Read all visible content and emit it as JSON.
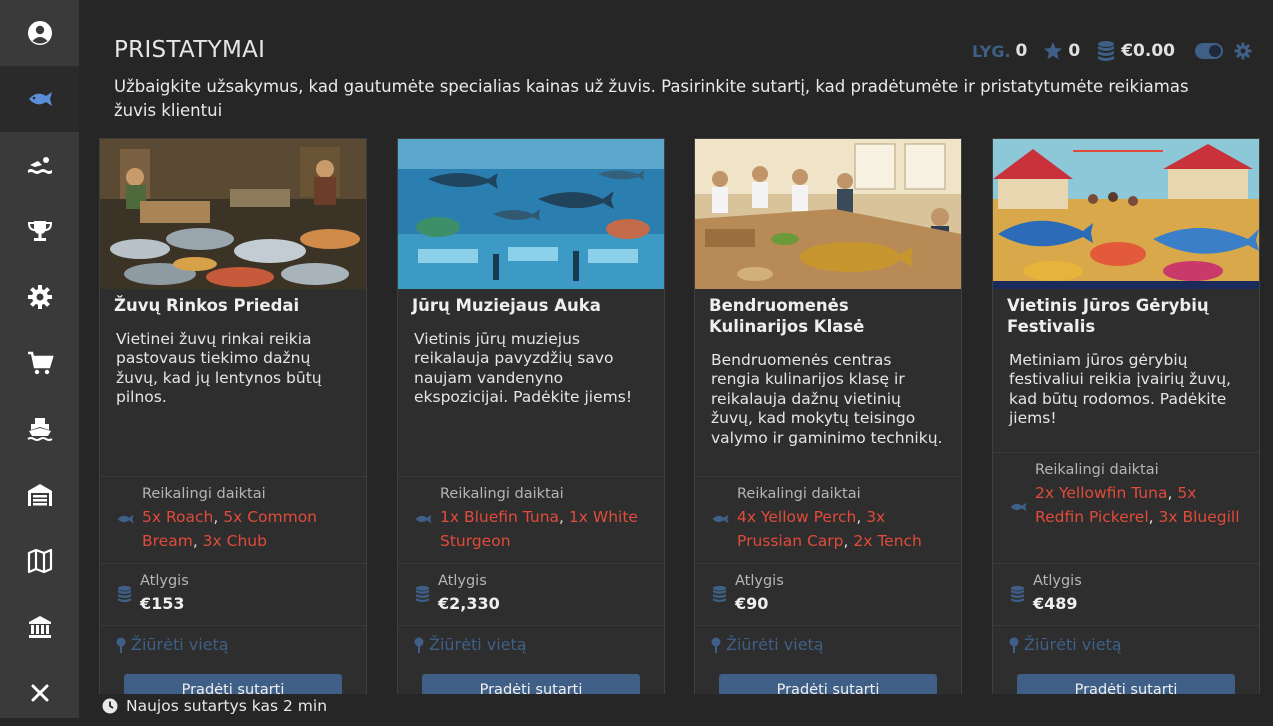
{
  "header": {
    "title": "PRISTATYMAI",
    "description": "Užbaigkite užsakymus, kad gautumėte specialias kainas už žuvis. Pasirinkite sutartį, kad pradėtumėte ir pristatytumėte reikiamas žuvis klientui",
    "level_label": "LYG.",
    "level_value": "0",
    "stars_value": "0",
    "money_value": "€0.00"
  },
  "sidebar": {
    "items": [
      {
        "icon": "user-icon"
      },
      {
        "icon": "fish-icon",
        "active": true
      },
      {
        "icon": "swimmer-icon"
      },
      {
        "icon": "trophy-icon"
      },
      {
        "icon": "gear-icon"
      },
      {
        "icon": "cart-icon"
      },
      {
        "icon": "ship-icon"
      },
      {
        "icon": "warehouse-icon"
      },
      {
        "icon": "map-icon"
      },
      {
        "icon": "bank-icon"
      },
      {
        "icon": "close-icon"
      }
    ]
  },
  "labels": {
    "required": "Reikalingi daiktai",
    "reward": "Atlygis",
    "view_location": "Žiūrėti vietą",
    "start_contract": "Pradėti sutartį"
  },
  "cards": [
    {
      "title": "Žuvų Rinkos Priedai",
      "body": "Vietinei žuvų rinkai reikia pastovaus tiekimo dažnų žuvų, kad jų lentynos būtų pilnos.",
      "items": [
        "5x Roach",
        "5x Common Bream",
        "3x Chub"
      ],
      "reward": "€153"
    },
    {
      "title": "Jūrų Muziejaus Auka",
      "body": "Vietinis jūrų muziejus reikalauja pavyzdžių savo naujam vandenyno ekspozicijai. Padėkite jiems!",
      "items": [
        "1x Bluefin Tuna",
        "1x White Sturgeon"
      ],
      "reward": "€2,330"
    },
    {
      "title": "Bendruomenės Kulinarijos Klasė",
      "body": "Bendruomenės centras rengia kulinarijos klasę ir reikalauja dažnų vietinių žuvų, kad mokytų teisingo valymo ir gaminimo technikų.",
      "items": [
        "4x Yellow Perch",
        "3x Prussian Carp",
        "2x Tench"
      ],
      "reward": "€90"
    },
    {
      "title": "Vietinis Jūros Gėrybių Festivalis",
      "body": "Metiniam jūros gėrybių festivaliui reikia įvairių žuvų, kad būtų rodomos. Padėkite jiems!",
      "items": [
        "2x Yellowfin Tuna",
        "5x Redfin Pickerel",
        "3x Bluegill"
      ],
      "reward": "€489"
    }
  ],
  "footer": {
    "text": "Naujos sutartys kas 2 min"
  },
  "colors": {
    "accent": "#3f5f86",
    "item_red": "#e04b3a",
    "background": "#262626",
    "sidebar": "#3a3a3a",
    "card": "#2e2e2e"
  }
}
